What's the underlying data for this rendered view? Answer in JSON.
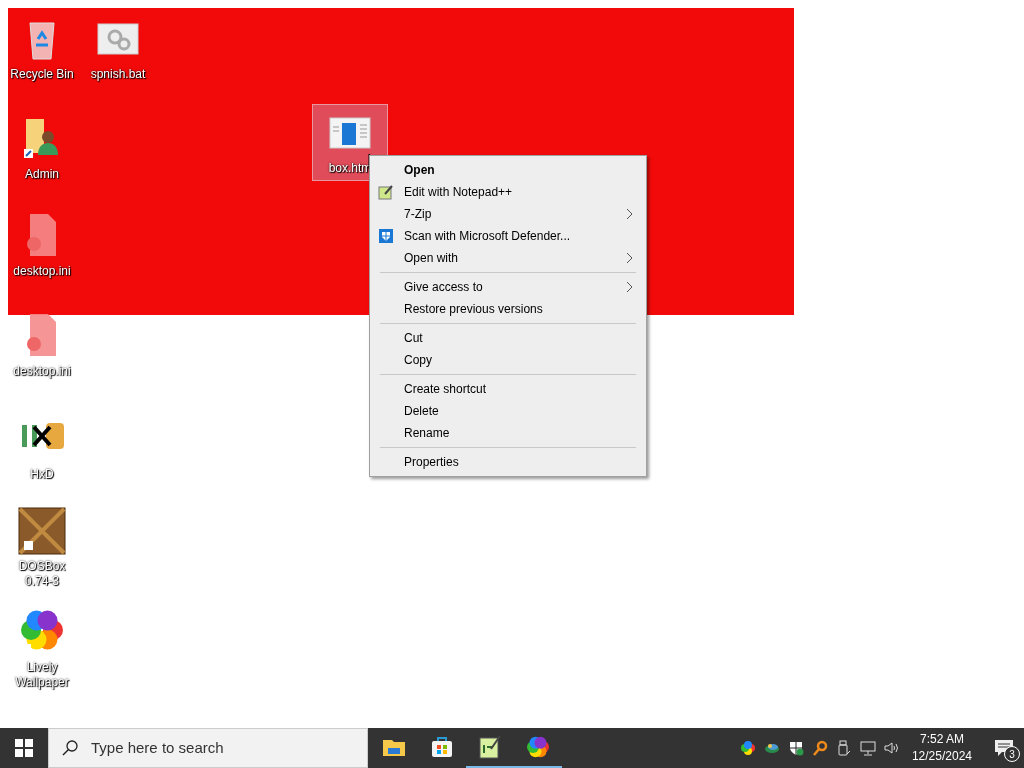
{
  "desktop": {
    "icons": [
      {
        "label": "Recycle Bin",
        "kind": "recycle-bin",
        "selected": false
      },
      {
        "label": "spnish.bat",
        "kind": "batch-file",
        "selected": false
      },
      {
        "label": "Admin",
        "kind": "user-folder",
        "selected": false
      },
      {
        "label": "desktop.ini",
        "kind": "settings-file",
        "selected": false
      },
      {
        "label": "desktop.ini",
        "kind": "settings-file",
        "selected": false
      },
      {
        "label": "HxD",
        "kind": "hex-editor",
        "selected": false
      },
      {
        "label": "DOSBox 0.74-3",
        "kind": "dosbox",
        "selected": false
      },
      {
        "label": "Lively Wallpaper",
        "kind": "flower",
        "selected": false
      },
      {
        "label": "box.htm",
        "kind": "html-file",
        "selected": true
      }
    ]
  },
  "context_menu": {
    "items": [
      {
        "kind": "item",
        "label": "Open",
        "bold": true,
        "submenu": false
      },
      {
        "kind": "notepad",
        "label": "Edit with Notepad++",
        "bold": false,
        "submenu": false
      },
      {
        "kind": "item",
        "label": "7-Zip",
        "bold": false,
        "submenu": true
      },
      {
        "kind": "shield",
        "label": "Scan with Microsoft Defender...",
        "bold": false,
        "submenu": false
      },
      {
        "kind": "item",
        "label": "Open with",
        "bold": false,
        "submenu": true
      },
      {
        "kind": "separator"
      },
      {
        "kind": "item",
        "label": "Give access to",
        "bold": false,
        "submenu": true
      },
      {
        "kind": "item",
        "label": "Restore previous versions",
        "bold": false,
        "submenu": false
      },
      {
        "kind": "separator"
      },
      {
        "kind": "item",
        "label": "Cut",
        "bold": false,
        "submenu": false
      },
      {
        "kind": "item",
        "label": "Copy",
        "bold": false,
        "submenu": false
      },
      {
        "kind": "separator"
      },
      {
        "kind": "item",
        "label": "Create shortcut",
        "bold": false,
        "submenu": false
      },
      {
        "kind": "item",
        "label": "Delete",
        "bold": false,
        "submenu": false
      },
      {
        "kind": "item",
        "label": "Rename",
        "bold": false,
        "submenu": false
      },
      {
        "kind": "separator"
      },
      {
        "kind": "item",
        "label": "Properties",
        "bold": false,
        "submenu": false
      }
    ]
  },
  "taskbar": {
    "search": {
      "placeholder": "Type here to search"
    },
    "apps": [
      {
        "kind": "folder",
        "running": false
      },
      {
        "kind": "store",
        "running": false
      },
      {
        "kind": "notepad",
        "running": true
      },
      {
        "kind": "flower",
        "running": true
      }
    ],
    "tray": [
      {
        "kind": "flower"
      },
      {
        "kind": "colors"
      },
      {
        "kind": "shield"
      },
      {
        "kind": "magnifier"
      },
      {
        "kind": "usb"
      },
      {
        "kind": "network"
      },
      {
        "kind": "volume"
      }
    ],
    "time": "7:52 AM",
    "date": "12/25/2024",
    "notifications": "3"
  }
}
